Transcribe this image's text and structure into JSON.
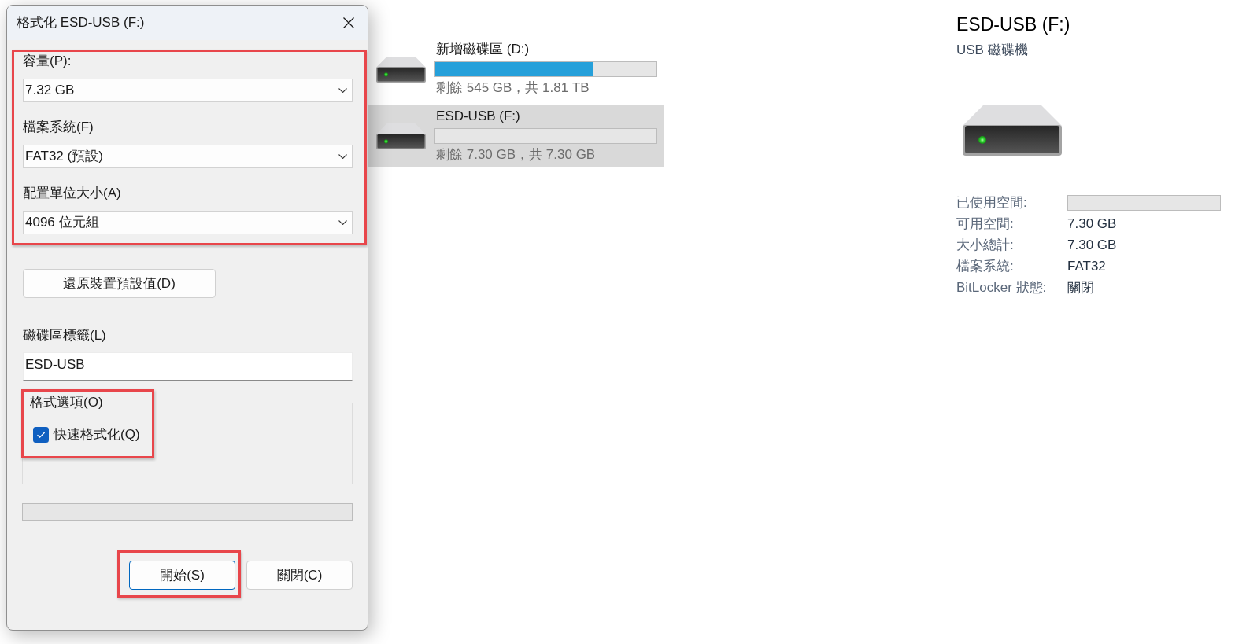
{
  "dialog": {
    "title": "格式化 ESD-USB (F:)",
    "settings": {
      "highlighted": true,
      "fields": [
        {
          "label": "容量(P):",
          "value": "7.32 GB"
        },
        {
          "label": "檔案系統(F)",
          "value": "FAT32 (預設)"
        },
        {
          "label": "配置單位大小(A)",
          "value": "4096 位元組"
        }
      ]
    },
    "restore_defaults_button": "還原裝置預設值(D)",
    "volume_label": {
      "label": "磁碟區標籤(L)",
      "value": "ESD-USB"
    },
    "format_options": {
      "title": "格式選項(O)",
      "highlighted": true,
      "quick_format": {
        "label": "快速格式化(Q)",
        "checked": true
      }
    },
    "progress": {
      "level": 0
    },
    "buttons": [
      {
        "label": "開始(S)",
        "default": true,
        "highlighted": true
      },
      {
        "label": "關閉(C)",
        "default": false,
        "highlighted": false
      }
    ]
  },
  "drives": [
    {
      "name": "新增磁碟區 (D:)",
      "level": 0.71,
      "free_text": "剩餘 545 GB，共 1.81 TB",
      "selected": false
    },
    {
      "name": "ESD-USB (F:)",
      "level": 0,
      "free_text": "剩餘 7.30 GB，共 7.30 GB",
      "selected": true
    }
  ],
  "details": {
    "title": "ESD-USB (F:)",
    "subtitle": "USB 磁碟機",
    "properties": [
      {
        "kind": "bar",
        "label": "已使用空間:",
        "level": 0
      },
      {
        "kind": "text",
        "label": "可用空間:",
        "value": "7.30 GB"
      },
      {
        "kind": "text",
        "label": "大小總計:",
        "value": "7.30 GB"
      },
      {
        "kind": "text",
        "label": "檔案系統:",
        "value": "FAT32"
      },
      {
        "kind": "text",
        "label": "BitLocker 狀態:",
        "value": "關閉"
      }
    ]
  }
}
